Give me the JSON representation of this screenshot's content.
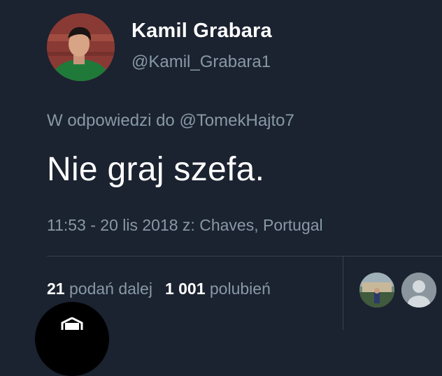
{
  "user": {
    "display_name": "Kamil Grabara",
    "handle": "@Kamil_Grabara1",
    "avatar_icon": "profile-photo"
  },
  "reply": {
    "prefix": "W odpowiedzi do",
    "mention": "@TomekHajto7"
  },
  "tweet": {
    "text": "Nie graj szefa.",
    "timestamp": "11:53 - 20 lis 2018 z: Chaves, Portugal"
  },
  "stats": {
    "retweets_count": "21",
    "retweets_label": "podań dalej",
    "likes_count": "1 001",
    "likes_label": "polubień"
  },
  "likers": [
    {
      "icon": "liker-photo"
    },
    {
      "icon": "default-avatar-icon"
    }
  ],
  "colors": {
    "background": "#1b2230",
    "text_primary": "#ffffff",
    "text_secondary": "#8899a6",
    "divider": "#38444d"
  }
}
